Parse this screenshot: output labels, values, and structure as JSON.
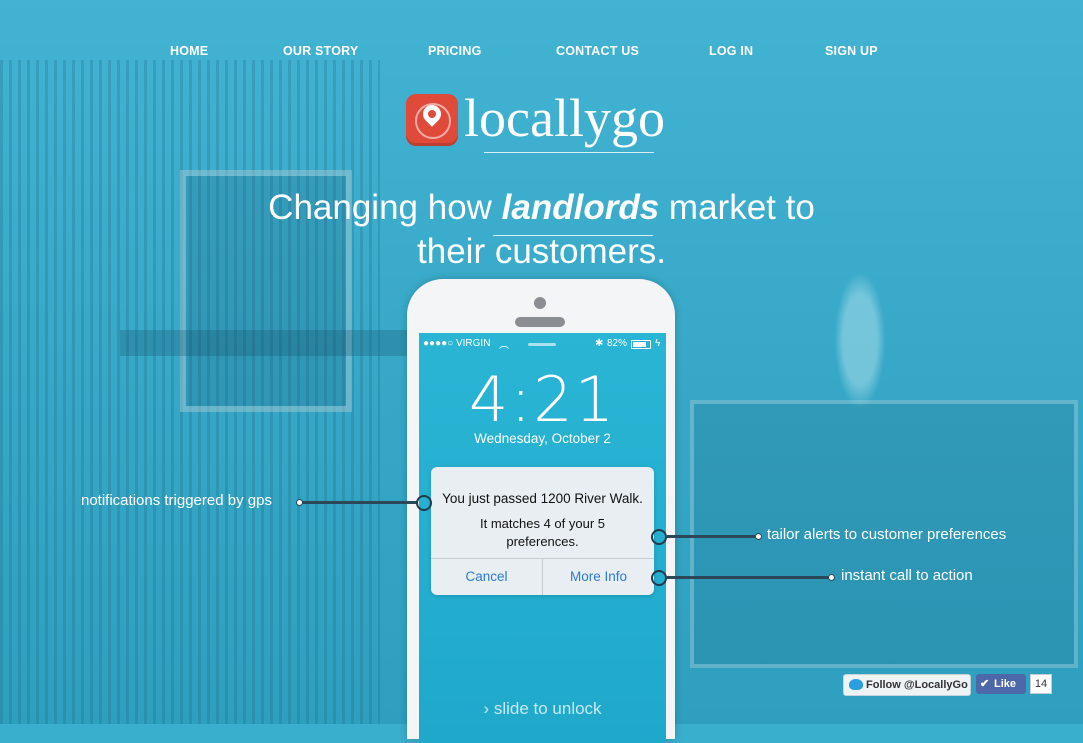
{
  "nav": {
    "items": [
      "HOME",
      "OUR STORY",
      "PRICING",
      "CONTACT US",
      "LOG IN",
      "SIGN UP"
    ]
  },
  "brand": {
    "name": "locallygo",
    "badge_color": "#e04a3b"
  },
  "hero": {
    "headline_pre": "Changing how ",
    "headline_em": "landlords",
    "headline_post": " market to",
    "headline_line2": "their customers."
  },
  "phone": {
    "carrier": "●●●●○ VIRGIN",
    "battery": "82%",
    "time": "4:21",
    "date": "Wednesday, October 2",
    "slide": "slide to unlock",
    "alert": {
      "title": "You just passed 1200 River Walk.",
      "body": "It matches 4 of your 5 preferences.",
      "cancel": "Cancel",
      "more": "More Info"
    }
  },
  "callouts": {
    "gps": "notifications triggered by gps",
    "tailor": "tailor alerts to customer preferences",
    "action": "instant call to action"
  },
  "social": {
    "twitter": "Follow @LocallyGo",
    "like": "Like",
    "like_count": "14"
  },
  "colors": {
    "background": "#3aaecd",
    "screen": "#2ab5d5",
    "link_blue": "#2a7ad6"
  }
}
